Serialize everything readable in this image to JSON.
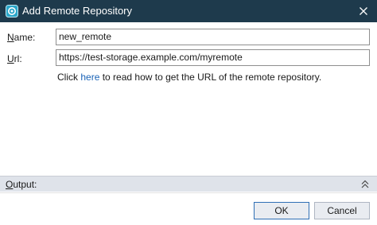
{
  "window": {
    "title": "Add Remote Repository",
    "close_icon": "close-icon",
    "app_icon": "repository-app-icon"
  },
  "form": {
    "name_label_key": "N",
    "name_label_rest": "ame:",
    "name_value": "new_remote",
    "url_label_key": "U",
    "url_label_rest": "rl:",
    "url_value": "https://test-storage.example.com/myremote",
    "help_prefix": "Click ",
    "help_link": "here",
    "help_suffix": " to read how to get the URL of the remote repository."
  },
  "output": {
    "label_key": "O",
    "label_rest": "utput:",
    "toggle_icon": "double-chevron-up-icon"
  },
  "buttons": {
    "ok": "OK",
    "cancel": "Cancel"
  }
}
